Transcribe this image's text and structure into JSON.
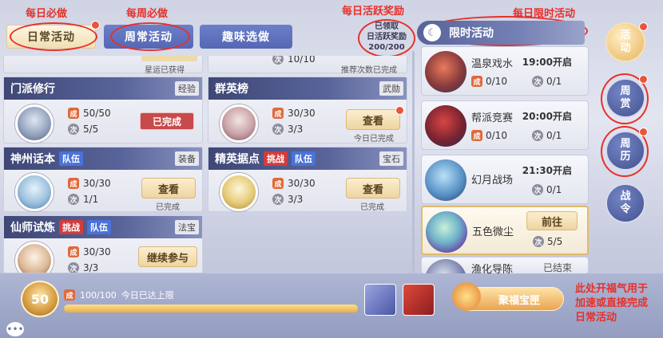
{
  "tabs": [
    {
      "label": "日常活动",
      "active": true
    },
    {
      "label": "周常活动",
      "active": false
    },
    {
      "label": "趣味选做",
      "active": false
    }
  ],
  "annotations": {
    "daily": "每日必做",
    "weekly": "每周必做",
    "active_reward": "每日活跃奖励",
    "limited": "每日限时活动",
    "blessing": [
      "此处开福气用于",
      "加速或直接完成",
      "日常活动"
    ]
  },
  "reward_box": {
    "line1": "已领取",
    "line2": "日活跃奖励",
    "count": "200/200"
  },
  "partial_top": {
    "left_note": "星运已获得",
    "right_count": "10/10",
    "right_note": "推荐次数已完成"
  },
  "activities": [
    {
      "name": "门派修行",
      "tags": [],
      "category": "经验",
      "progress": "50/50",
      "times": "5/5",
      "button": "已完成",
      "button_type": "done",
      "note": ""
    },
    {
      "name": "群英榜",
      "tags": [],
      "category": "武勋",
      "progress": "30/30",
      "times": "3/3",
      "button": "查看",
      "button_type": "view",
      "note": "今日已完成"
    },
    {
      "name": "神州话本",
      "tags": [
        "队伍"
      ],
      "category": "装备",
      "progress": "30/30",
      "times": "1/1",
      "button": "查看",
      "button_type": "view",
      "note": "已完成"
    },
    {
      "name": "精英据点",
      "tags": [
        "挑战",
        "队伍"
      ],
      "category": "宝石",
      "progress": "30/30",
      "times": "3/3",
      "button": "查看",
      "button_type": "view",
      "note": "已完成"
    },
    {
      "name": "仙师试炼",
      "tags": [
        "挑战",
        "队伍"
      ],
      "category": "法宝",
      "progress": "30/30",
      "times": "3/3",
      "button": "继续参与",
      "button_type": "view",
      "note": ""
    }
  ],
  "limited_header": "限时活动",
  "limited": [
    {
      "name": "温泉戏水",
      "time": "19:00开启",
      "progress": "0/10",
      "times": "0/1",
      "button": ""
    },
    {
      "name": "帮派竞赛",
      "time": "20:00开启",
      "progress": "0/10",
      "times": "0/1",
      "button": ""
    },
    {
      "name": "幻月战场",
      "time": "21:30开启",
      "progress": "",
      "times": "0/1",
      "button": ""
    },
    {
      "name": "五色微尘",
      "time": "",
      "progress": "",
      "times": "5/5",
      "button": "前往"
    },
    {
      "name": "渔化导陈",
      "time": "",
      "progress": "",
      "times": "",
      "button": "已结束"
    }
  ],
  "side_buttons": [
    {
      "label": "活动",
      "active": true
    },
    {
      "label": "周赏",
      "active": false
    },
    {
      "label": "周历",
      "active": false
    },
    {
      "label": "战令",
      "active": false
    }
  ],
  "bottom": {
    "level": "50",
    "activity_value": "100/100",
    "activity_note": "今日已达上限",
    "activity_fraction": 1.0,
    "blessing_button": "聚福宝匣"
  },
  "icon_labels": {
    "progress": "成",
    "times": "次"
  },
  "colors": {
    "annotation": "#e8302a",
    "accent_gold": "#e7b35c",
    "header_blue": "#58639a"
  }
}
